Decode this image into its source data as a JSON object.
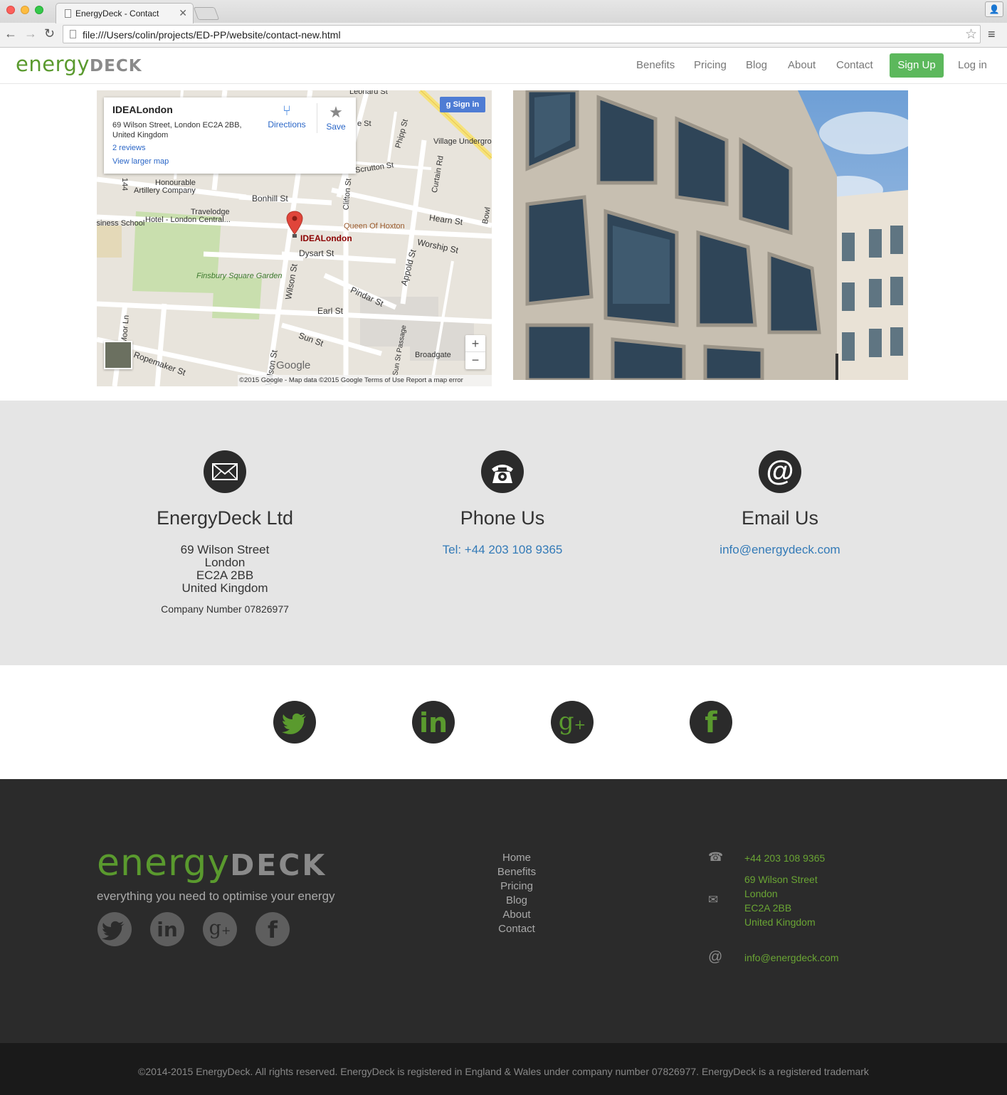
{
  "browser": {
    "tab_title": "EnergyDeck - Contact",
    "url": "file:///Users/colin/projects/ED-PP/website/contact-new.html"
  },
  "nav": {
    "logo_energy": "energy",
    "logo_deck": "DECK",
    "links": [
      "Benefits",
      "Pricing",
      "Blog",
      "About",
      "Contact"
    ],
    "signup": "Sign Up",
    "login": "Log in"
  },
  "map": {
    "place_name": "IDEALondon",
    "address": "69 Wilson Street, London EC2A 2BB, United Kingdom",
    "reviews": "2 reviews",
    "larger_map": "View larger map",
    "directions": "Directions",
    "save": "Save",
    "sign_in": "Sign in",
    "pin_label": "IDEALondon",
    "labels": {
      "leonard": "Leonard St",
      "honourable": "Honourable",
      "artillery": "Artillery Company",
      "bonhill": "Bonhill St",
      "travelodge": "Travelodge",
      "hotel": "Hotel - London Central...",
      "school": "Business School",
      "queen": "Queen Of Hoxton",
      "hearn": "Hearn St",
      "worship": "Worship St",
      "dysart": "Dysart St",
      "finsbury": "Finsbury Square Garden",
      "wilson": "Wilson St",
      "appold": "Appold St",
      "pindar": "Pindar St",
      "earl": "Earl St",
      "sun": "Sun St",
      "broadgate": "Broadgate",
      "ropemaker": "Ropemaker St",
      "moorln": "Moor Ln",
      "clifton": "Clifton St",
      "curtain": "Curtain Rd",
      "scrutton": "Scrutton St",
      "phipp": "Phipp St",
      "village": "Village Undergro",
      "sunpass": "Sun St Passage",
      "wilson2": "Wilson St",
      "bowl": "Bowl",
      "n144": "144",
      "est": "e St"
    },
    "google": "Google",
    "footer": "©2015 Google - Map data ©2015 Google    Terms of Use    Report a map error"
  },
  "contact": {
    "company": {
      "title": "EnergyDeck Ltd",
      "line1": "69 Wilson Street",
      "line2": "London",
      "line3": "EC2A 2BB",
      "line4": "United Kingdom",
      "number": "Company Number 07826977"
    },
    "phone": {
      "title": "Phone Us",
      "value": "Tel: +44 203 108 9365"
    },
    "email": {
      "title": "Email Us",
      "value": "info@energydeck.com"
    }
  },
  "footer": {
    "logo_energy": "energy",
    "logo_deck": "DECK",
    "tagline": "everything you need to optimise your energy",
    "links": [
      "Home",
      "Benefits",
      "Pricing",
      "Blog",
      "About",
      "Contact"
    ],
    "phone": "+44 203 108 9365",
    "address": [
      "69 Wilson Street",
      "London",
      "EC2A 2BB",
      "United Kingdom"
    ],
    "email": "info@energdeck.com",
    "copyright": "©2014-2015 EnergyDeck. All rights reserved. EnergyDeck is registered in England & Wales under company number 07826977. EnergyDeck is a registered trademark"
  },
  "colors": {
    "brand_green": "#5a9a2e",
    "signup_green": "#5cb85c",
    "link_blue": "#337ab7"
  }
}
